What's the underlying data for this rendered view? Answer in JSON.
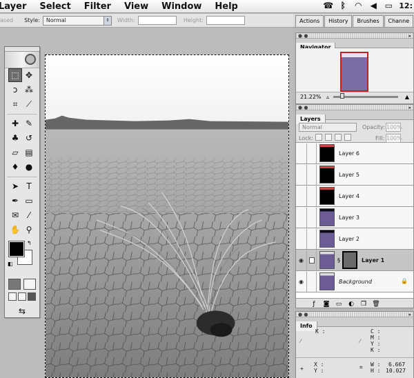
{
  "menubar": {
    "items": [
      "Layer",
      "Select",
      "Filter",
      "View",
      "Window",
      "Help"
    ],
    "clock": "12:"
  },
  "options_bar": {
    "antialias_label": "ased",
    "style_label": "Style:",
    "style_value": "Normal",
    "width_label": "Width:",
    "height_label": "Height:"
  },
  "palette_well": {
    "tabs": [
      "Actions",
      "History",
      "Brushes",
      "Channe"
    ]
  },
  "toolbox": {
    "tools": [
      [
        "marquee-tool",
        "move-tool"
      ],
      [
        "lasso-tool",
        "magic-wand-tool"
      ],
      [
        "crop-tool",
        "slice-tool"
      ],
      [
        "healing-brush-tool",
        "brush-tool"
      ],
      [
        "clone-stamp-tool",
        "history-brush-tool"
      ],
      [
        "eraser-tool",
        "gradient-tool"
      ],
      [
        "blur-tool",
        "dodge-tool"
      ],
      [
        "path-selection-tool",
        "type-tool"
      ],
      [
        "pen-tool",
        "rectangle-tool"
      ],
      [
        "notes-tool",
        "eyedropper-tool"
      ],
      [
        "hand-tool",
        "zoom-tool"
      ]
    ],
    "foreground_color": "#000000",
    "background_color": "#ffffff"
  },
  "navigator": {
    "title": "Navigator",
    "zoom": "21.22%"
  },
  "layers": {
    "title": "Layers",
    "blend_mode": "Normal",
    "opacity_label": "Opacity:",
    "opacity": "100%",
    "lock_label": "Lock:",
    "fill_label": "Fill:",
    "fill": "100%",
    "rows": [
      {
        "name": "Layer 6",
        "selected": false,
        "visible": false,
        "thumb": "red"
      },
      {
        "name": "Layer 5",
        "selected": false,
        "visible": false,
        "thumb": "red"
      },
      {
        "name": "Layer 4",
        "selected": false,
        "visible": false,
        "thumb": "red"
      },
      {
        "name": "Layer 3",
        "selected": false,
        "visible": false,
        "thumb": "photo2"
      },
      {
        "name": "Layer 2",
        "selected": false,
        "visible": false,
        "thumb": "photo2"
      },
      {
        "name": "Layer 1",
        "selected": true,
        "visible": true,
        "thumb": "photo"
      },
      {
        "name": "Background",
        "selected": false,
        "visible": true,
        "thumb": "photo"
      }
    ]
  },
  "info": {
    "title": "Info",
    "k_label": "K :",
    "cmyk_labels": "C :\nM :\nY :\nK :",
    "xy_labels": "X :\nY :",
    "w_label": "W :",
    "h_label": "H :",
    "w_value": "6.667",
    "h_value": "10.027"
  },
  "colors": {
    "accent_select": "#6b5c96",
    "thumb_border": "#b22222"
  }
}
